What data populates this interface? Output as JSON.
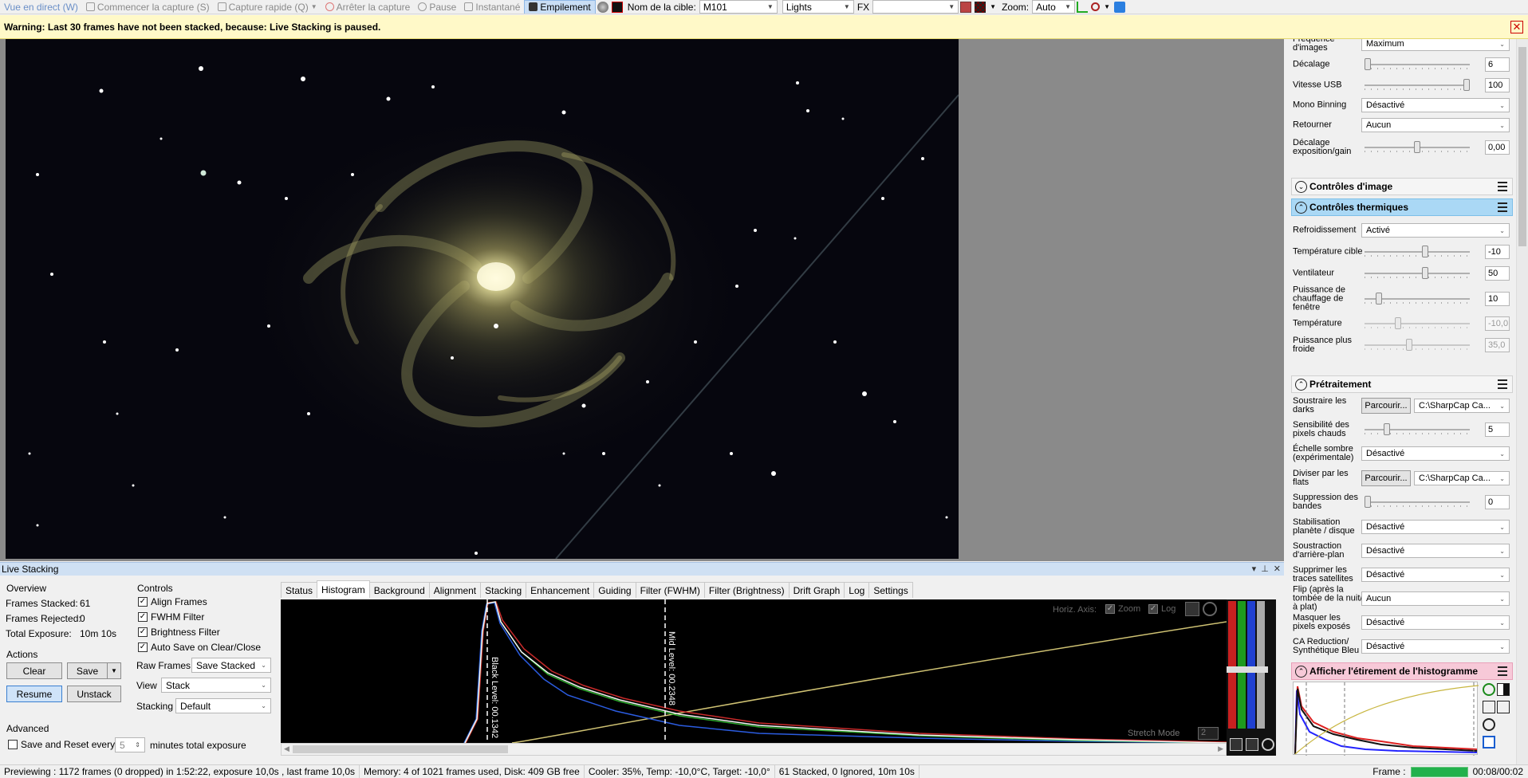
{
  "toolbar": {
    "live_view": "Vue en direct (W)",
    "start_capture": "Commencer la capture (S)",
    "quick_capture": "Capture rapide (Q)",
    "stop_capture": "Arrêter la capture",
    "pause": "Pause",
    "snapshot": "Instantané",
    "stacking": "Empilement",
    "target_label": "Nom de la cible:",
    "target_value": "M101",
    "frame_type": "Lights",
    "fx_label": "FX",
    "fx_value": "",
    "zoom_label": "Zoom:",
    "zoom_value": "Auto"
  },
  "warning": {
    "text": "Warning: Last 30 frames have not been stacked, because: Live Stacking is paused."
  },
  "right_panel": {
    "top_row": {
      "label": "Fréquence d'images",
      "value": "Maximum"
    },
    "rows": [
      {
        "label": "Décalage",
        "value": "6",
        "knob": 0.02
      },
      {
        "label": "Vitesse USB",
        "value": "100",
        "knob": 0.98
      },
      {
        "label": "Mono Binning",
        "select": "Désactivé"
      },
      {
        "label": "Retourner",
        "select": "Aucun"
      },
      {
        "label": "Décalage exposition/gain",
        "value": "0,00",
        "knob": 0.5
      }
    ],
    "section_image": "Contrôles d'image",
    "section_thermal": "Contrôles thermiques",
    "thermal": {
      "cooling_label": "Refroidissement",
      "cooling_value": "Activé",
      "target_temp_label": "Température cible",
      "target_temp_value": "-10",
      "fan_label": "Ventilateur",
      "fan_value": "50",
      "heater_label": "Puissance de chauffage de fenêtre",
      "heater_value": "10",
      "temp_label": "Température",
      "temp_value": "-10,0",
      "coldest_label": "Puissance plus froide",
      "coldest_value": "35,0"
    },
    "section_preprocess": "Prétraitement",
    "preprocess": {
      "darks_label": "Soustraire les darks",
      "browse": "Parcourir...",
      "darks_path": "C:\\SharpCap Ca...",
      "hot_label": "Sensibilité des pixels chauds",
      "hot_value": "5",
      "dark_scale_label": "Échelle sombre (expérimentale)",
      "dark_scale_value": "Désactivé",
      "flats_label": "Diviser par les flats",
      "flats_path": "C:\\SharpCap Ca...",
      "banding_label": "Suppression des bandes",
      "banding_value": "0",
      "planet_label": "Stabilisation planète / disque",
      "planet_value": "Désactivé",
      "bg_label": "Soustraction d'arrière-plan",
      "bg_value": "Désactivé",
      "sat_label": "Supprimer les traces satellites",
      "sat_value": "Désactivé",
      "flip_label": "Flip (après la tombée de la nuit/à plat)",
      "flip_value": "Aucun",
      "mask_label": "Masquer les pixels exposés",
      "mask_value": "Désactivé",
      "ca_label": "CA Reduction/ Synthétique Bleu",
      "ca_value": "Désactivé"
    },
    "section_histogram": "Afficher l'étirement de l'histogramme"
  },
  "live_stacking": {
    "title": "Live Stacking",
    "overview_title": "Overview",
    "frames_stacked_label": "Frames Stacked:",
    "frames_stacked_value": "61",
    "frames_rejected_label": "Frames Rejected:",
    "frames_rejected_value": "0",
    "total_exposure_label": "Total Exposure:",
    "total_exposure_value": "10m 10s",
    "actions_title": "Actions",
    "clear": "Clear",
    "save": "Save",
    "resume": "Resume",
    "unstack": "Unstack",
    "advanced_title": "Advanced",
    "save_reset_label": "Save and Reset every",
    "save_reset_value": "5",
    "save_reset_suffix": "minutes total exposure",
    "controls_title": "Controls",
    "align_frames": "Align Frames",
    "fwhm_filter": "FWHM Filter",
    "brightness_filter": "Brightness Filter",
    "auto_save": "Auto Save on Clear/Close",
    "raw_frames_label": "Raw Frames",
    "raw_frames_value": "Save Stacked",
    "view_label": "View",
    "view_value": "Stack",
    "stacking_label": "Stacking",
    "stacking_value": "Default",
    "tabs": [
      "Status",
      "Histogram",
      "Background",
      "Alignment",
      "Stacking",
      "Enhancement",
      "Guiding",
      "Filter (FWHM)",
      "Filter (Brightness)",
      "Drift Graph",
      "Log",
      "Settings"
    ],
    "active_tab": 1,
    "histogram": {
      "horiz_axis": "Horiz. Axis:",
      "zoom": "Zoom",
      "log": "Log",
      "black_level": "Black Level: 00.1342",
      "mid_level": "Mid Level: 00.2348",
      "stretch_mode": "Stretch Mode",
      "stretch_value": "2"
    }
  },
  "status_bar": {
    "preview": "Previewing : 1172 frames (0 dropped) in 1:52:22, exposure 10,0s , last frame 10,0s",
    "memory": "Memory: 4 of 1021 frames used, Disk: 409 GB free",
    "cooler": "Cooler: 35%, Temp: -10,0°C, Target: -10,0°",
    "stacked": "61 Stacked, 0 Ignored, 10m 10s",
    "frame_label": "Frame :",
    "frame_time": "00:08/00:02"
  },
  "colors": {
    "accent": "#3a7fd0",
    "warning_bg": "#fff9c8",
    "frame_progress": "#22b14c",
    "thermal_header": "#aad8f5",
    "histogram_header": "#f7c9d8"
  }
}
